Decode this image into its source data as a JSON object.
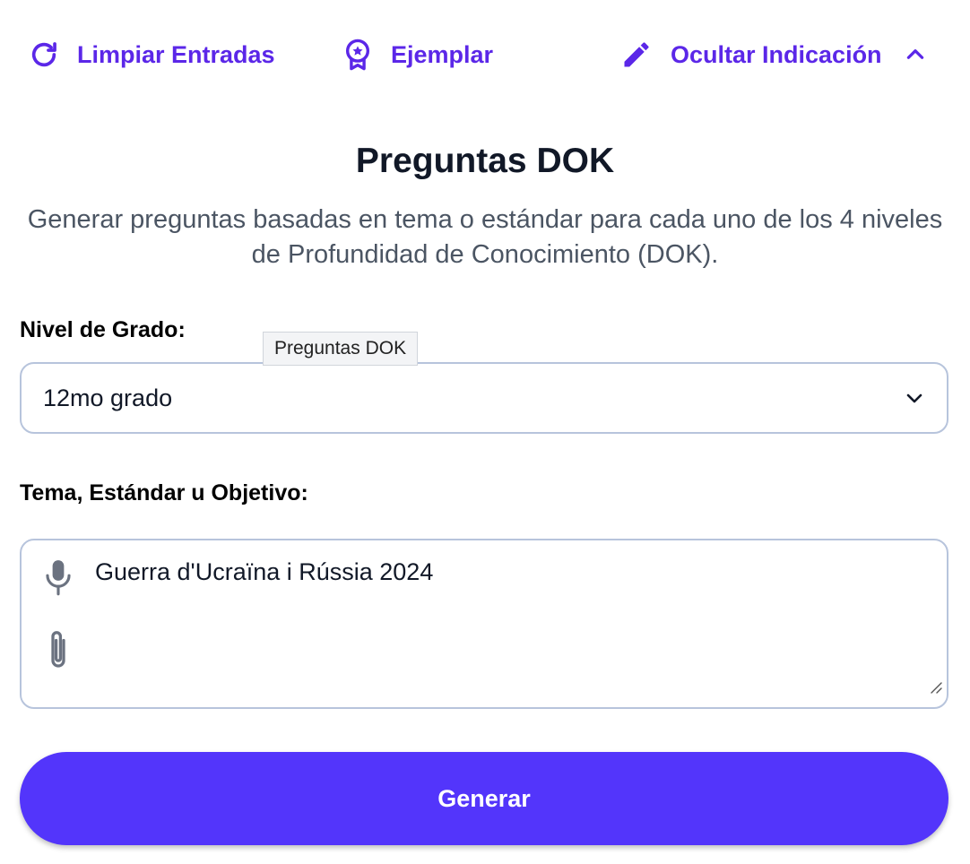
{
  "toolbar": {
    "clear_label": "Limpiar Entradas",
    "example_label": "Ejemplar",
    "hide_label": "Ocultar Indicación",
    "icons": {
      "clear": "refresh-icon",
      "example": "award-badge-icon",
      "hide": "pencil-icon",
      "collapse": "chevron-up-icon"
    }
  },
  "header": {
    "title": "Preguntas DOK",
    "subtitle": "Generar preguntas basadas en tema o estándar para cada uno de los 4 niveles de Profundidad de Conocimiento (DOK)."
  },
  "tooltip": "Preguntas DOK",
  "form": {
    "grade_label": "Nivel de Grado:",
    "grade_value": "12mo grado",
    "topic_label": "Tema, Estándar u Objetivo:",
    "topic_value": "Guerra d'Ucraïna i Rússia 2024",
    "icons": {
      "mic": "microphone-icon",
      "attach": "paperclip-icon",
      "select": "chevron-down-icon"
    }
  },
  "generate_label": "Generar",
  "colors": {
    "accent": "#5b27e8",
    "button": "#5335fb",
    "border": "#b7c4dc",
    "muted_text": "#4b5563"
  }
}
